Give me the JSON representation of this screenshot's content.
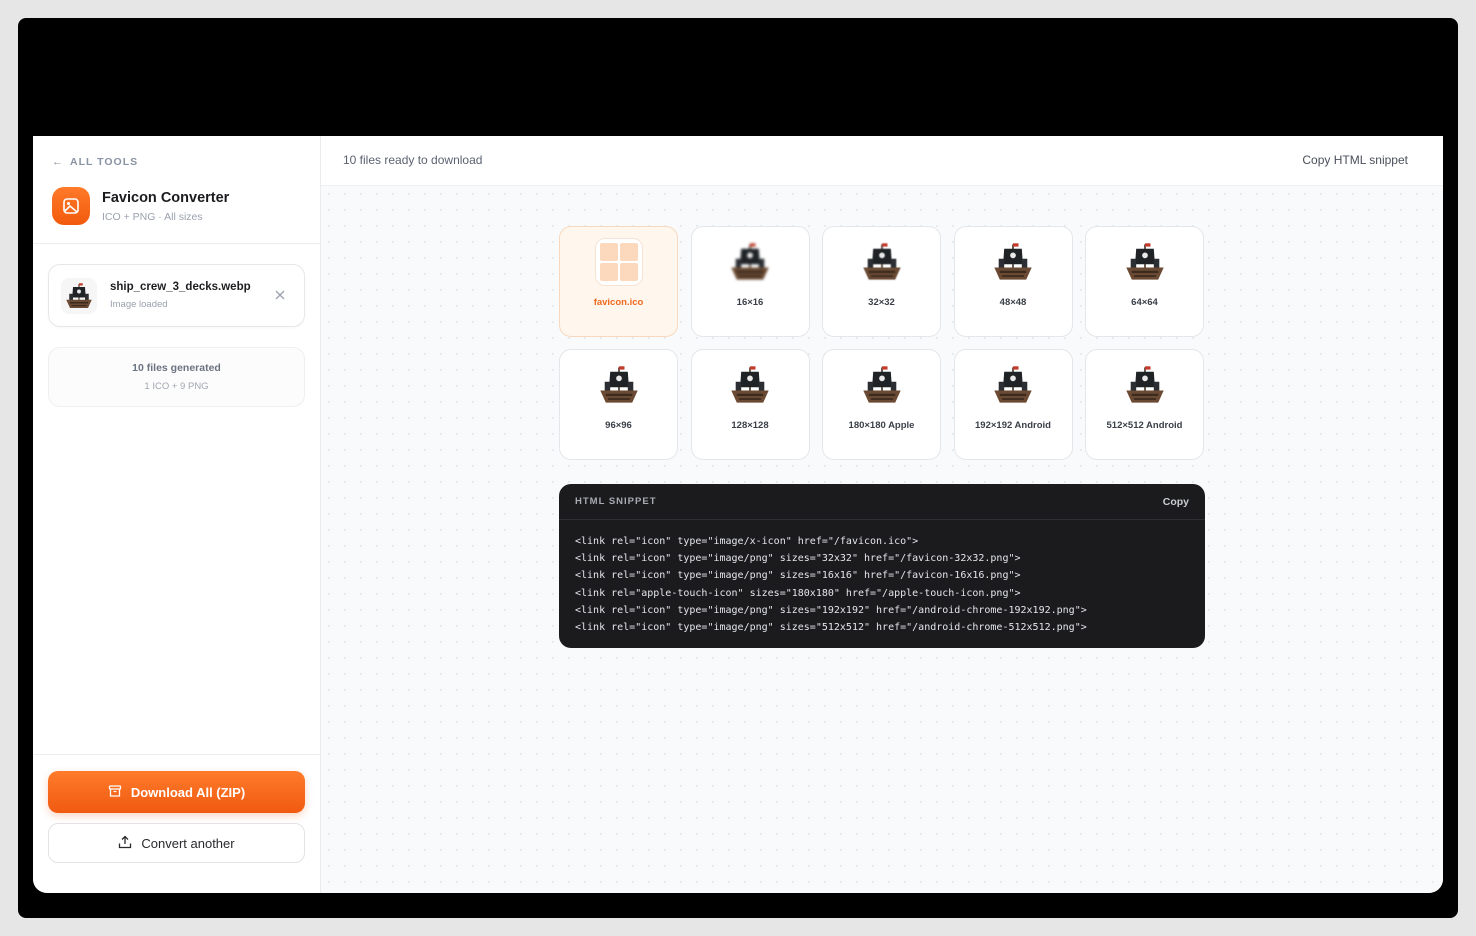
{
  "sidebar": {
    "back_label": "ALL TOOLS",
    "title": "Favicon Converter",
    "subtitle": "ICO + PNG · All sizes",
    "file": {
      "name": "ship_crew_3_decks.webp",
      "status": "Image loaded"
    },
    "generated": {
      "title": "10 files generated",
      "sub": "1 ICO + 9 PNG"
    },
    "download_label": "Download All (ZIP)",
    "convert_label": "Convert another"
  },
  "topbar": {
    "status": "10 files ready to download",
    "copy_label": "Copy HTML snippet"
  },
  "tiles": [
    {
      "label": "favicon.ico",
      "kind": "ico"
    },
    {
      "label": "16×16",
      "kind": "png"
    },
    {
      "label": "32×32",
      "kind": "png"
    },
    {
      "label": "48×48",
      "kind": "png"
    },
    {
      "label": "64×64",
      "kind": "png"
    },
    {
      "label": "96×96",
      "kind": "png"
    },
    {
      "label": "128×128",
      "kind": "png"
    },
    {
      "label": "180×180 Apple",
      "kind": "png"
    },
    {
      "label": "192×192 Android",
      "kind": "png"
    },
    {
      "label": "512×512 Android",
      "kind": "png"
    }
  ],
  "snippet": {
    "title": "HTML SNIPPET",
    "copy_label": "Copy",
    "lines": [
      "<link rel=\"icon\" type=\"image/x-icon\" href=\"/favicon.ico\">",
      "<link rel=\"icon\" type=\"image/png\" sizes=\"32x32\" href=\"/favicon-32x32.png\">",
      "<link rel=\"icon\" type=\"image/png\" sizes=\"16x16\" href=\"/favicon-16x16.png\">",
      "<link rel=\"apple-touch-icon\" sizes=\"180x180\" href=\"/apple-touch-icon.png\">",
      "<link rel=\"icon\" type=\"image/png\" sizes=\"192x192\" href=\"/android-chrome-192x192.png\">",
      "<link rel=\"icon\" type=\"image/png\" sizes=\"512x512\" href=\"/android-chrome-512x512.png\">"
    ]
  },
  "colors": {
    "accent": "#f25a0c",
    "code_bg": "#1b1b1e"
  }
}
